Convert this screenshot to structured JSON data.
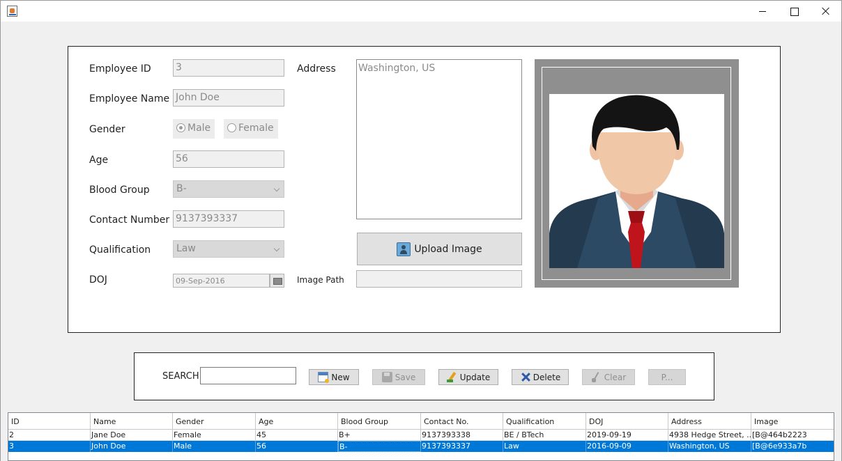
{
  "window": {
    "title": "",
    "controls": [
      "minimize-icon",
      "maximize-icon",
      "close-icon"
    ]
  },
  "form": {
    "labels": {
      "employee_id": "Employee ID",
      "employee_name": "Employee Name",
      "gender": "Gender",
      "age": "Age",
      "blood_group": "Blood Group",
      "contact_number": "Contact Number",
      "qualification": "Qualification",
      "doj": "DOJ",
      "address": "Address",
      "image_path": "Image Path"
    },
    "values": {
      "employee_id": "3",
      "employee_name": "John Doe",
      "gender_selected": "Male",
      "age": "56",
      "blood_group": "B-",
      "contact_number": "9137393337",
      "qualification": "Law",
      "doj": "09-Sep-2016",
      "address": "Washington, US",
      "image_path": ""
    },
    "gender_options": [
      "Male",
      "Female"
    ],
    "upload_label": "Upload Image"
  },
  "toolbar": {
    "search_label": "SEARCH",
    "search_value": "",
    "buttons": {
      "new": "New",
      "save": "Save",
      "update": "Update",
      "delete": "Delete",
      "clear": "Clear",
      "print": "P..."
    }
  },
  "table": {
    "columns": [
      "ID",
      "Name",
      "Gender",
      "Age",
      "Blood Group",
      "Contact No.",
      "Qualification",
      "DOJ",
      "Address",
      "Image"
    ],
    "rows": [
      [
        "2",
        "Jane Doe",
        "Female",
        "45",
        "B+",
        "9137393338",
        "BE / BTech",
        "2019-09-19",
        "4938 Hedge Street, ...",
        "[B@464b2223"
      ],
      [
        "3",
        "John Doe",
        "Male",
        "56",
        "B-",
        "9137393337",
        "Law",
        "2016-09-09",
        "Washington, US",
        "[B@6e933a7b"
      ]
    ],
    "selected_row": 1
  },
  "colors": {
    "selection": "#0078d7",
    "window_bg": "#f0f0f0",
    "tie": "#c0141c",
    "suit": "#233a4f"
  }
}
